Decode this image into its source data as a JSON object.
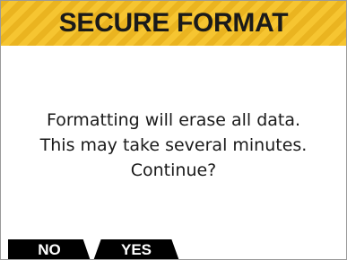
{
  "header": {
    "title": "SECURE FORMAT"
  },
  "message": {
    "lines": [
      "Formatting will erase all data.",
      "This may take several minutes.",
      "Continue?"
    ]
  },
  "softkeys": {
    "no_label": "NO",
    "yes_label": "YES"
  },
  "colors": {
    "header_stripe_light": "#f6c531",
    "header_stripe_dark": "#eab420",
    "softkey_background": "#000000",
    "softkey_text": "#ffffff",
    "text": "#1a1a1a"
  }
}
